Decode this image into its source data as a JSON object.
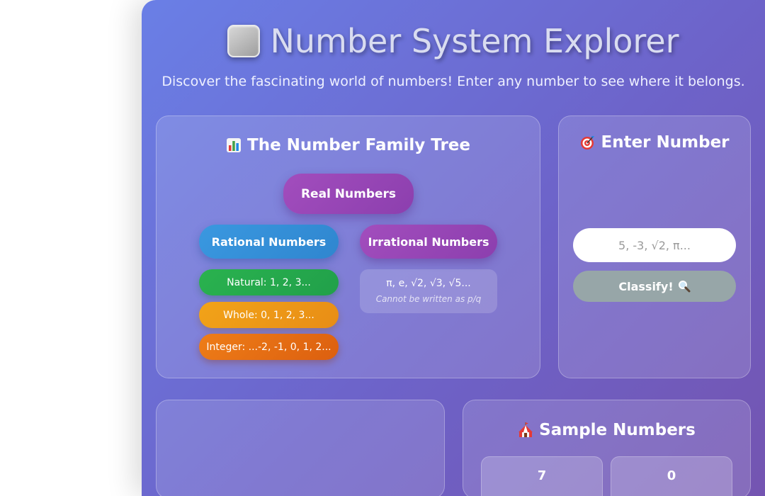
{
  "header": {
    "title": "Number System Explorer",
    "subtitle": "Discover the fascinating world of numbers! Enter any number to see where it belongs.",
    "title_icon": "gray-square-icon"
  },
  "tree": {
    "heading": "The Number Family Tree",
    "heading_icon": "bar-chart-icon",
    "real": "Real Numbers",
    "rational": "Rational Numbers",
    "irrational": "Irrational Numbers",
    "natural": "Natural: 1, 2, 3...",
    "whole": "Whole: 0, 1, 2, 3...",
    "integer": "Integer: ...-2, -1, 0, 1, 2...",
    "irrational_examples": "π, e, √2, √3, √5...",
    "irrational_note": "Cannot be written as p/q"
  },
  "input_panel": {
    "heading": "Enter Number",
    "heading_icon": "target-icon",
    "placeholder": "5, -3, √2, π...",
    "button_label": "Classify!",
    "button_icon": "magnifier-icon"
  },
  "samples": {
    "heading": "Sample Numbers",
    "heading_icon": "circus-tent-icon",
    "items": [
      "7",
      "0"
    ]
  },
  "colors": {
    "background_start": "#6a7fe6",
    "background_end": "#7454b0",
    "real": "#9a47b8",
    "rational": "#3590d8",
    "irrational": "#9a47b8",
    "natural": "#25aa4d",
    "whole": "#ee9817",
    "integer": "#e56e13",
    "button": "#97a6a8"
  }
}
